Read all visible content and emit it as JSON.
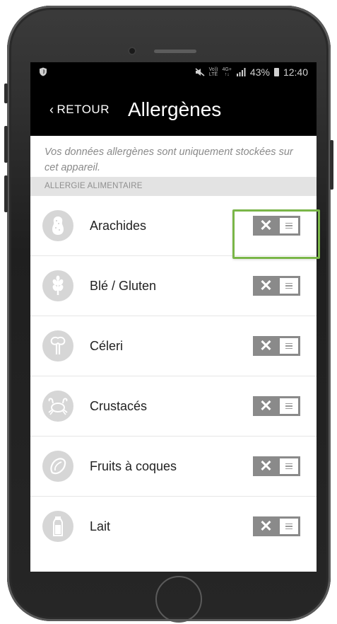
{
  "statusbar": {
    "volte": "Vo))",
    "lte": "LTE",
    "fourg": "4G+",
    "battery_percent": "43%",
    "time": "12:40"
  },
  "header": {
    "back_label": "RETOUR",
    "title": "Allergènes"
  },
  "intro_text": "Vos données allergènes sont uniquement stockées sur cet appareil.",
  "section_label": "ALLERGIE ALIMENTAIRE",
  "toggle_off_symbol": "✕",
  "allergens": [
    {
      "label": "Arachides",
      "icon": "peanut-icon",
      "enabled": false
    },
    {
      "label": "Blé / Gluten",
      "icon": "wheat-icon",
      "enabled": false
    },
    {
      "label": "Céleri",
      "icon": "celery-icon",
      "enabled": false
    },
    {
      "label": "Crustacés",
      "icon": "crab-icon",
      "enabled": false
    },
    {
      "label": "Fruits à coques",
      "icon": "nut-icon",
      "enabled": false
    },
    {
      "label": "Lait",
      "icon": "milk-bottle-icon",
      "enabled": false
    }
  ],
  "colors": {
    "header_bg": "#000000",
    "toggle_bg": "#8a8a8a",
    "highlight": "#7ab648",
    "section_bg": "#e3e3e3"
  }
}
